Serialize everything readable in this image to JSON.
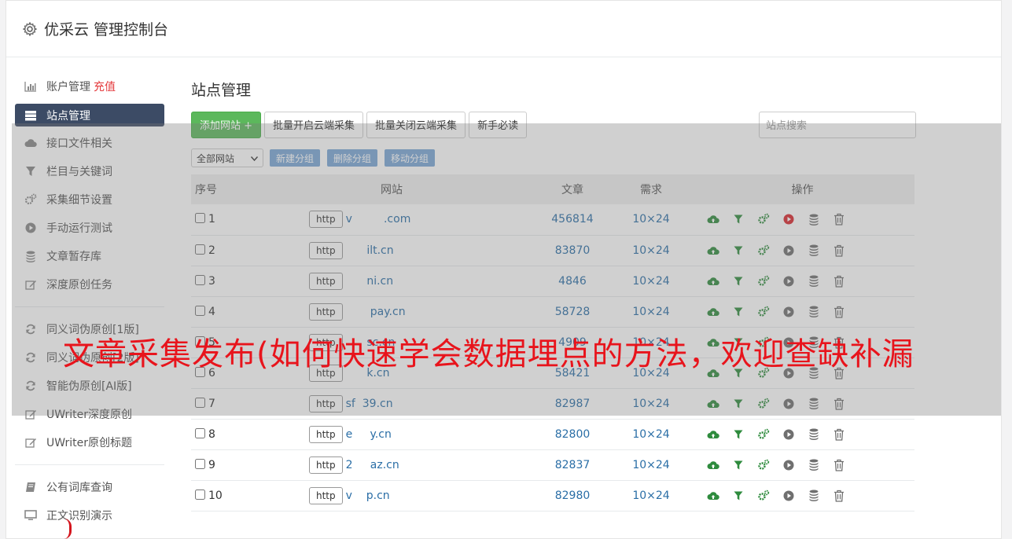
{
  "app": {
    "title": "优采云 管理控制台"
  },
  "sidebar": {
    "items": [
      {
        "label": "账户管理",
        "extra": "充值",
        "icon": "bar-chart-icon"
      },
      {
        "label": "站点管理",
        "icon": "server-icon",
        "active": true
      },
      {
        "label": "接口文件相关",
        "icon": "cloud-upload-icon"
      },
      {
        "label": "栏目与关键词",
        "icon": "filter-icon"
      },
      {
        "label": "采集细节设置",
        "icon": "cogs-icon"
      },
      {
        "label": "手动运行测试",
        "icon": "play-circle-icon"
      },
      {
        "label": "文章暂存库",
        "icon": "database-icon"
      },
      {
        "label": "深度原创任务",
        "icon": "edit-icon"
      },
      {
        "label": "同义词伪原创[1版]",
        "icon": "refresh-icon"
      },
      {
        "label": "同义词伪原创[2版]",
        "icon": "refresh-icon"
      },
      {
        "label": "智能伪原创[AI版]",
        "icon": "refresh-icon"
      },
      {
        "label": "UWriter深度原创",
        "icon": "edit-icon"
      },
      {
        "label": "UWriter原创标题",
        "icon": "edit-icon"
      },
      {
        "label": "公有词库查询",
        "icon": "book-icon"
      },
      {
        "label": "正文识别演示",
        "icon": "monitor-icon"
      }
    ]
  },
  "main": {
    "title": "站点管理",
    "toolbar": {
      "add_site": "添加网站 +",
      "batch_open": "批量开启云端采集",
      "batch_close": "批量关闭云端采集",
      "newbie": "新手必读",
      "search_placeholder": "站点搜索"
    },
    "toolbar2": {
      "group_select": "全部网站",
      "new_group": "新建分组",
      "delete_group": "删除分组",
      "move_group": "移动分组"
    },
    "table": {
      "headers": {
        "no": "序号",
        "site": "网站",
        "articles": "文章",
        "demand": "需求",
        "ops": "操作"
      },
      "rows": [
        {
          "no": "1",
          "proto": "http",
          "domain": "v         .com",
          "articles": "456814",
          "demand": "10×24",
          "running": true
        },
        {
          "no": "2",
          "proto": "http",
          "domain": "      ilt.cn",
          "articles": "83870",
          "demand": "10×24"
        },
        {
          "no": "3",
          "proto": "http",
          "domain": "      ni.cn",
          "articles": "4846",
          "demand": "10×24"
        },
        {
          "no": "4",
          "proto": "http",
          "domain": "       pay.cn",
          "articles": "58728",
          "demand": "10×24"
        },
        {
          "no": "5",
          "proto": "http",
          "domain": "      sc.cn",
          "articles": "4909",
          "demand": "10×24"
        },
        {
          "no": "6",
          "proto": "http",
          "domain": "      k.cn",
          "articles": "58421",
          "demand": "10×24"
        },
        {
          "no": "7",
          "proto": "http",
          "domain": "sf  39.cn",
          "articles": "82987",
          "demand": "10×24"
        },
        {
          "no": "8",
          "proto": "http",
          "domain": "e     y.cn",
          "articles": "82800",
          "demand": "10×24"
        },
        {
          "no": "9",
          "proto": "http",
          "domain": "2     az.cn",
          "articles": "82837",
          "demand": "10×24"
        },
        {
          "no": "10",
          "proto": "http",
          "domain": "v    p.cn",
          "articles": "82980",
          "demand": "10×24"
        }
      ]
    }
  },
  "overlay": {
    "banner": "文章采集发布(如何快速学会数据埋点的方法，欢迎查缺补漏"
  },
  "colors": {
    "accent": "#3c4b65",
    "green": "#5cb85c",
    "link": "#2a6ea6",
    "banner": "#e8141c"
  }
}
